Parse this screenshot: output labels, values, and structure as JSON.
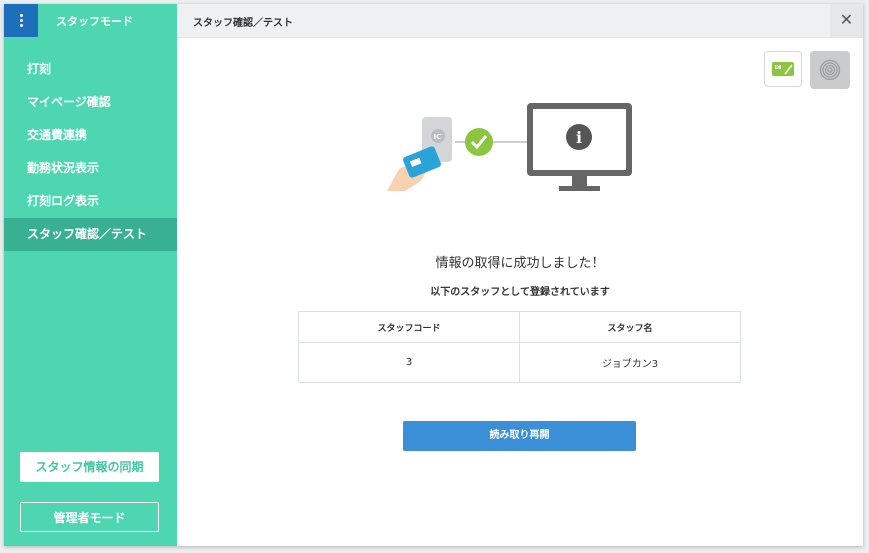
{
  "sidebar": {
    "mode_title": "スタッフモード",
    "items": [
      {
        "label": "打刻",
        "active": false
      },
      {
        "label": "マイページ確認",
        "active": false
      },
      {
        "label": "交通費連携",
        "active": false
      },
      {
        "label": "勤務状況表示",
        "active": false
      },
      {
        "label": "打刻ログ表示",
        "active": false
      },
      {
        "label": "スタッフ確認／テスト",
        "active": true
      }
    ],
    "sync_button": "スタッフ情報の同期",
    "admin_button": "管理者モード"
  },
  "topbar": {
    "title": "スタッフ確認／テスト",
    "close_symbol": "✕"
  },
  "read_modes": [
    {
      "icon": "ic-card-icon",
      "selected": true,
      "label": "IC"
    },
    {
      "icon": "fingerprint-icon",
      "selected": false
    }
  ],
  "illustration": {
    "card_label": "IC",
    "status_icon": "check-circle-icon",
    "monitor_symbol": "i"
  },
  "result": {
    "title": "情報の取得に成功しました！",
    "subtitle": "以下のスタッフとして登録されています",
    "table": {
      "headers": [
        "スタッフコード",
        "スタッフ名"
      ],
      "rows": [
        [
          "3",
          "ジョブカン3"
        ]
      ]
    }
  },
  "reread_button": "読み取り再開",
  "colors": {
    "sidebar_bg": "#4dd6b0",
    "sidebar_active": "#38b092",
    "menu_button": "#1e6fb9",
    "primary_button": "#3a8fd6",
    "success": "#8cc63f",
    "card_blue": "#2aa4d8"
  }
}
